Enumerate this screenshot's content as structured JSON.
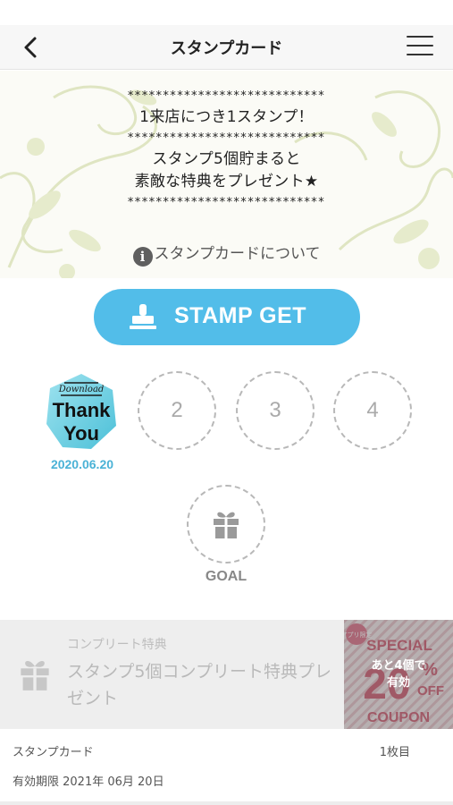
{
  "header": {
    "title": "スタンプカード",
    "back_icon": "chevron-left-icon",
    "menu_icon": "hamburger-menu-icon"
  },
  "banner": {
    "lines": [
      "****************************",
      "1来店につき1スタンプ！",
      "****************************",
      "スタンプ5個貯まると",
      "素敵な特典をプレゼント★",
      "****************************"
    ],
    "about_link": "スタンプカードについて"
  },
  "stamp_button": {
    "label": "STAMP GET",
    "icon": "stamp-icon",
    "color": "#52bde9"
  },
  "stamps": {
    "collected": [
      {
        "text_top": "Download",
        "text_main1": "Thank",
        "text_main2": "You",
        "date": "2020.06.20"
      }
    ],
    "empty_slots": [
      "2",
      "3",
      "4"
    ],
    "goal_label": "GOAL",
    "goal_icon": "gift-icon"
  },
  "bonus": {
    "category": "コンプリート特典",
    "title": "スタンプ5個コンプリート特典プレゼント",
    "coupon_special": "SPECIAL",
    "coupon_number": "20",
    "coupon_percent": "%",
    "coupon_off": "OFF",
    "coupon_word": "COUPON",
    "coupon_app": "アプリ限定",
    "remaining_line1": "あと4個で",
    "remaining_line2": "有効"
  },
  "footer": {
    "label": "スタンプカード",
    "count": "1枚目",
    "expiry": "有効期限 2021年 06月 20日"
  }
}
